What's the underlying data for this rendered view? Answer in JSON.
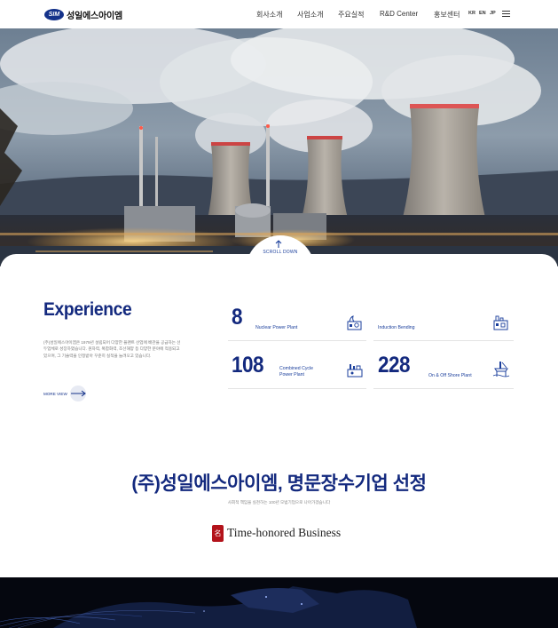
{
  "header": {
    "logo_badge": "SIM",
    "logo_text": "성일에스아이엠",
    "nav": [
      "회사소개",
      "사업소개",
      "주요실적",
      "R&D Center",
      "홍보센터"
    ],
    "languages": [
      "KR",
      "EN",
      "JP"
    ]
  },
  "hero": {
    "scroll_label": "SCROLL DOWN"
  },
  "experience": {
    "title": "Experience",
    "description": "(주)성일에스아이엠은 1979년 설립되어 다양한 플랜트 산업에 배관을 공급하는 선두업체로 성장하였습니다. 원자력, 복합화력, 조선해양 등 다양한 분야에 적용되고 있으며, 그 기술력을 인정받아 꾸준히 실적을 늘려오고 있습니다.",
    "more_view": "MORE VIEW",
    "stats": [
      {
        "number": "8",
        "label": "Nuclear Power Plant",
        "icon": "nuclear-plant-icon"
      },
      {
        "number": "",
        "label": "Induction Bending",
        "icon": "factory-icon"
      },
      {
        "number": "108",
        "label_line1": "Combined Cycle",
        "label_line2": "Power Plant",
        "icon": "power-plant-icon"
      },
      {
        "number": "228",
        "label": "On & Off Shore Plant",
        "icon": "offshore-rig-icon"
      }
    ]
  },
  "award": {
    "headline": "(주)성일에스아이엠, 명문장수기업 선정",
    "subline": "사회적 책임을 실천하는 100년 모범기업으로 나아가겠습니다",
    "seal_char": "名",
    "badge_text": "Time-honored Business"
  },
  "colors": {
    "brand_navy": "#13297e",
    "accent_blue": "#1b3f9c",
    "seal_red": "#b3131b"
  }
}
